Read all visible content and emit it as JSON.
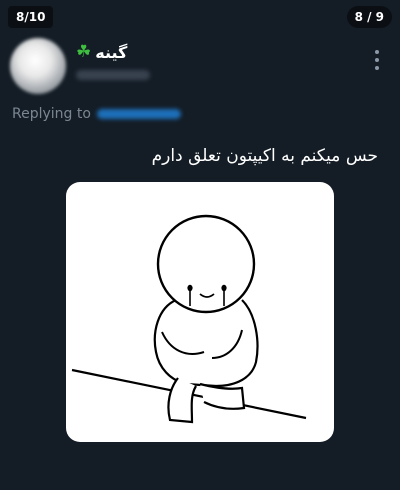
{
  "viewer": {
    "counter_left": "8/10",
    "counter_right": "8 / 9"
  },
  "tweet": {
    "author_name": "گینه",
    "author_emoji": "☘",
    "reply_label": "Replying to",
    "text": "حس میکنم به اکیپتون تعلق دارم"
  },
  "icons": {
    "more": "more-vertical-icon",
    "clover": "shamrock-icon"
  }
}
